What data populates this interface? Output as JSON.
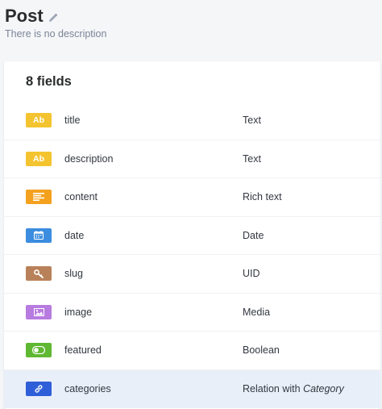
{
  "header": {
    "title": "Post",
    "description": "There is no description"
  },
  "card": {
    "title": "8 fields"
  },
  "fields": [
    {
      "name": "title",
      "type": "Text",
      "icon": "text-icon",
      "badge_text": "Ab",
      "color": "#f4c430"
    },
    {
      "name": "description",
      "type": "Text",
      "icon": "text-icon",
      "badge_text": "Ab",
      "color": "#f4c430"
    },
    {
      "name": "content",
      "type": "Rich text",
      "icon": "paragraph-icon",
      "color": "#f4a11f"
    },
    {
      "name": "date",
      "type": "Date",
      "icon": "calendar-icon",
      "color": "#3c8de0"
    },
    {
      "name": "slug",
      "type": "UID",
      "icon": "key-icon",
      "color": "#b9815a"
    },
    {
      "name": "image",
      "type": "Media",
      "icon": "image-icon",
      "color": "#b87be0"
    },
    {
      "name": "featured",
      "type": "Boolean",
      "icon": "toggle-icon",
      "color": "#5fb832"
    },
    {
      "name": "categories",
      "type": "Relation with",
      "type_target": "Category",
      "icon": "link-icon",
      "color": "#2f5fd8"
    }
  ],
  "colors": {
    "highlight_row": "#e9eff9"
  }
}
